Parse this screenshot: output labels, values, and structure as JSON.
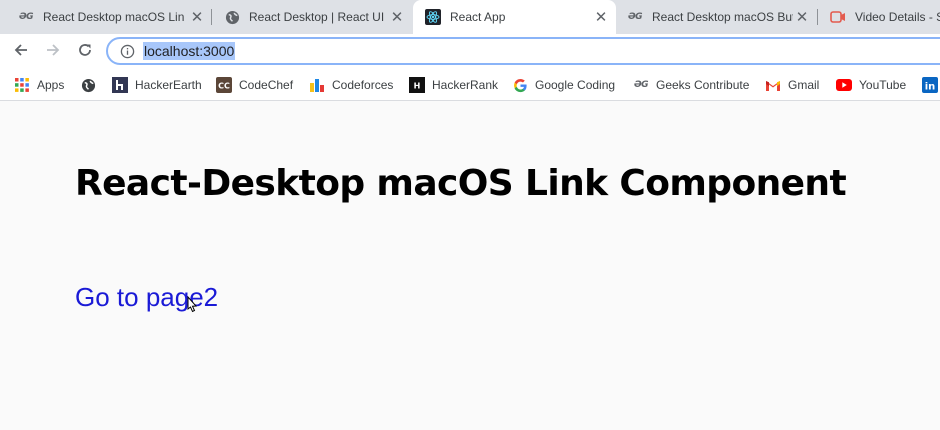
{
  "tabs": [
    {
      "title": "React Desktop macOS Lin",
      "favicon": "geeksforgeeks-icon",
      "active": false
    },
    {
      "title": "React Desktop | React UI C",
      "favicon": "globe-icon",
      "active": false
    },
    {
      "title": "React App",
      "favicon": "react-icon",
      "active": true
    },
    {
      "title": "React Desktop macOS But",
      "favicon": "geeksforgeeks-icon",
      "active": false
    },
    {
      "title": "Video Details - S",
      "favicon": "video-icon",
      "active": false
    }
  ],
  "toolbar": {
    "url": "localhost:3000",
    "back_icon": "back-arrow-icon",
    "forward_icon": "forward-arrow-icon",
    "reload_icon": "reload-icon",
    "site_info_icon": "info-icon"
  },
  "bookmarks": [
    {
      "label": "Apps",
      "icon": "apps-grid-icon"
    },
    {
      "label": "",
      "icon": "globe-icon"
    },
    {
      "label": "HackerEarth",
      "icon": "hackerearth-icon"
    },
    {
      "label": "CodeChef",
      "icon": "codechef-icon"
    },
    {
      "label": "Codeforces",
      "icon": "codeforces-icon"
    },
    {
      "label": "HackerRank",
      "icon": "hackerrank-icon"
    },
    {
      "label": "Google Coding",
      "icon": "google-icon"
    },
    {
      "label": "Geeks Contribute",
      "icon": "geeksforgeeks-icon"
    },
    {
      "label": "Gmail",
      "icon": "gmail-icon"
    },
    {
      "label": "YouTube",
      "icon": "youtube-icon"
    },
    {
      "label": "",
      "icon": "linkedin-icon"
    }
  ],
  "page": {
    "heading": "React-Desktop macOS Link Component",
    "link_text": "Go to page2"
  },
  "colors": {
    "tab_strip": "#dee1e6",
    "url_highlight": "#a8c7fa",
    "link": "#1a1ad6",
    "page_background": "#fafafa"
  }
}
